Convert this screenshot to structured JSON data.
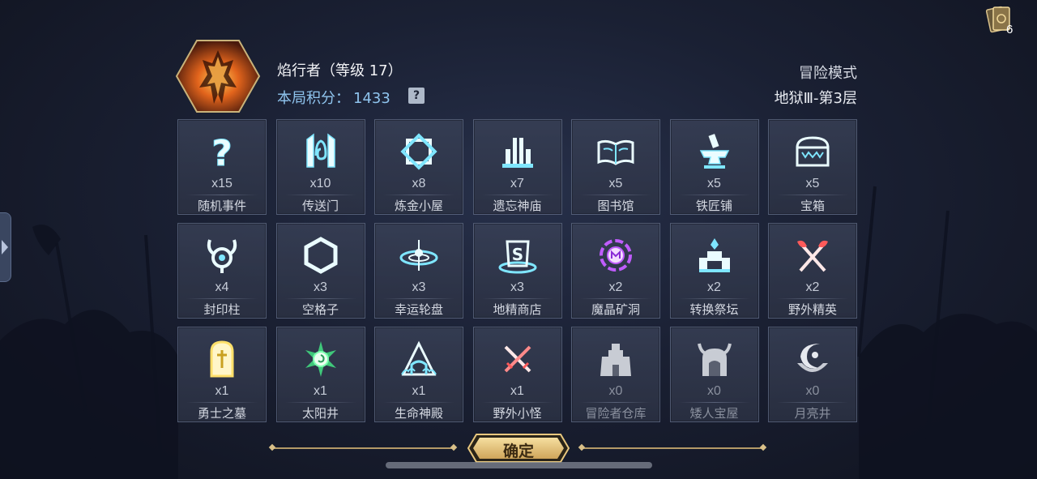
{
  "header": {
    "hero_name": "焰行者（等级 17）",
    "score_label": "本局积分：",
    "score_value": "1433",
    "help_label": "?",
    "mode": "冒险模式",
    "floor": "地狱Ⅲ-第3层"
  },
  "top_right": {
    "cards_count": "6",
    "cards_icon": "card-deck-icon"
  },
  "tiles": [
    {
      "count": "x15",
      "name": "随机事件",
      "icon": "question-mark-icon"
    },
    {
      "count": "x10",
      "name": "传送门",
      "icon": "portal-gate-icon"
    },
    {
      "count": "x8",
      "name": "炼金小屋",
      "icon": "alchemy-diamond-icon"
    },
    {
      "count": "x7",
      "name": "遗忘神庙",
      "icon": "temple-pillars-icon"
    },
    {
      "count": "x5",
      "name": "图书馆",
      "icon": "open-book-icon"
    },
    {
      "count": "x5",
      "name": "铁匠铺",
      "icon": "anvil-hammer-icon"
    },
    {
      "count": "x5",
      "name": "宝箱",
      "icon": "treasure-chest-icon"
    },
    {
      "count": "x4",
      "name": "封印柱",
      "icon": "horned-seal-icon"
    },
    {
      "count": "x3",
      "name": "空格子",
      "icon": "hexagon-icon"
    },
    {
      "count": "x3",
      "name": "幸运轮盘",
      "icon": "fortune-wheel-icon"
    },
    {
      "count": "x3",
      "name": "地精商店",
      "icon": "goblin-shop-icon"
    },
    {
      "count": "x2",
      "name": "魔晶矿洞",
      "icon": "magic-crystal-icon"
    },
    {
      "count": "x2",
      "name": "转换祭坛",
      "icon": "altar-icon"
    },
    {
      "count": "x2",
      "name": "野外精英",
      "icon": "crossed-axes-icon"
    },
    {
      "count": "x1",
      "name": "勇士之墓",
      "icon": "tombstone-icon"
    },
    {
      "count": "x1",
      "name": "太阳井",
      "icon": "sun-swirl-icon"
    },
    {
      "count": "x1",
      "name": "生命神殿",
      "icon": "life-shrine-icon"
    },
    {
      "count": "x1",
      "name": "野外小怪",
      "icon": "crossed-swords-icon"
    },
    {
      "count": "x0",
      "name": "冒险者仓库",
      "icon": "warehouse-tower-icon"
    },
    {
      "count": "x0",
      "name": "矮人宝屋",
      "icon": "dwarf-helmet-icon"
    },
    {
      "count": "x0",
      "name": "月亮井",
      "icon": "moon-well-icon"
    }
  ],
  "footer": {
    "confirm_label": "确定"
  },
  "colors": {
    "glow_cyan": "#7fe6ff",
    "gold": "#e8c77e",
    "score_blue": "#8fc4ee",
    "crystal_purple": "#c05cff",
    "elite_red": "#ff5a5a",
    "tomb_yellow": "#ffe06a",
    "sun_green": "#7dffb0",
    "inactive_grey": "#c8ccd4"
  }
}
